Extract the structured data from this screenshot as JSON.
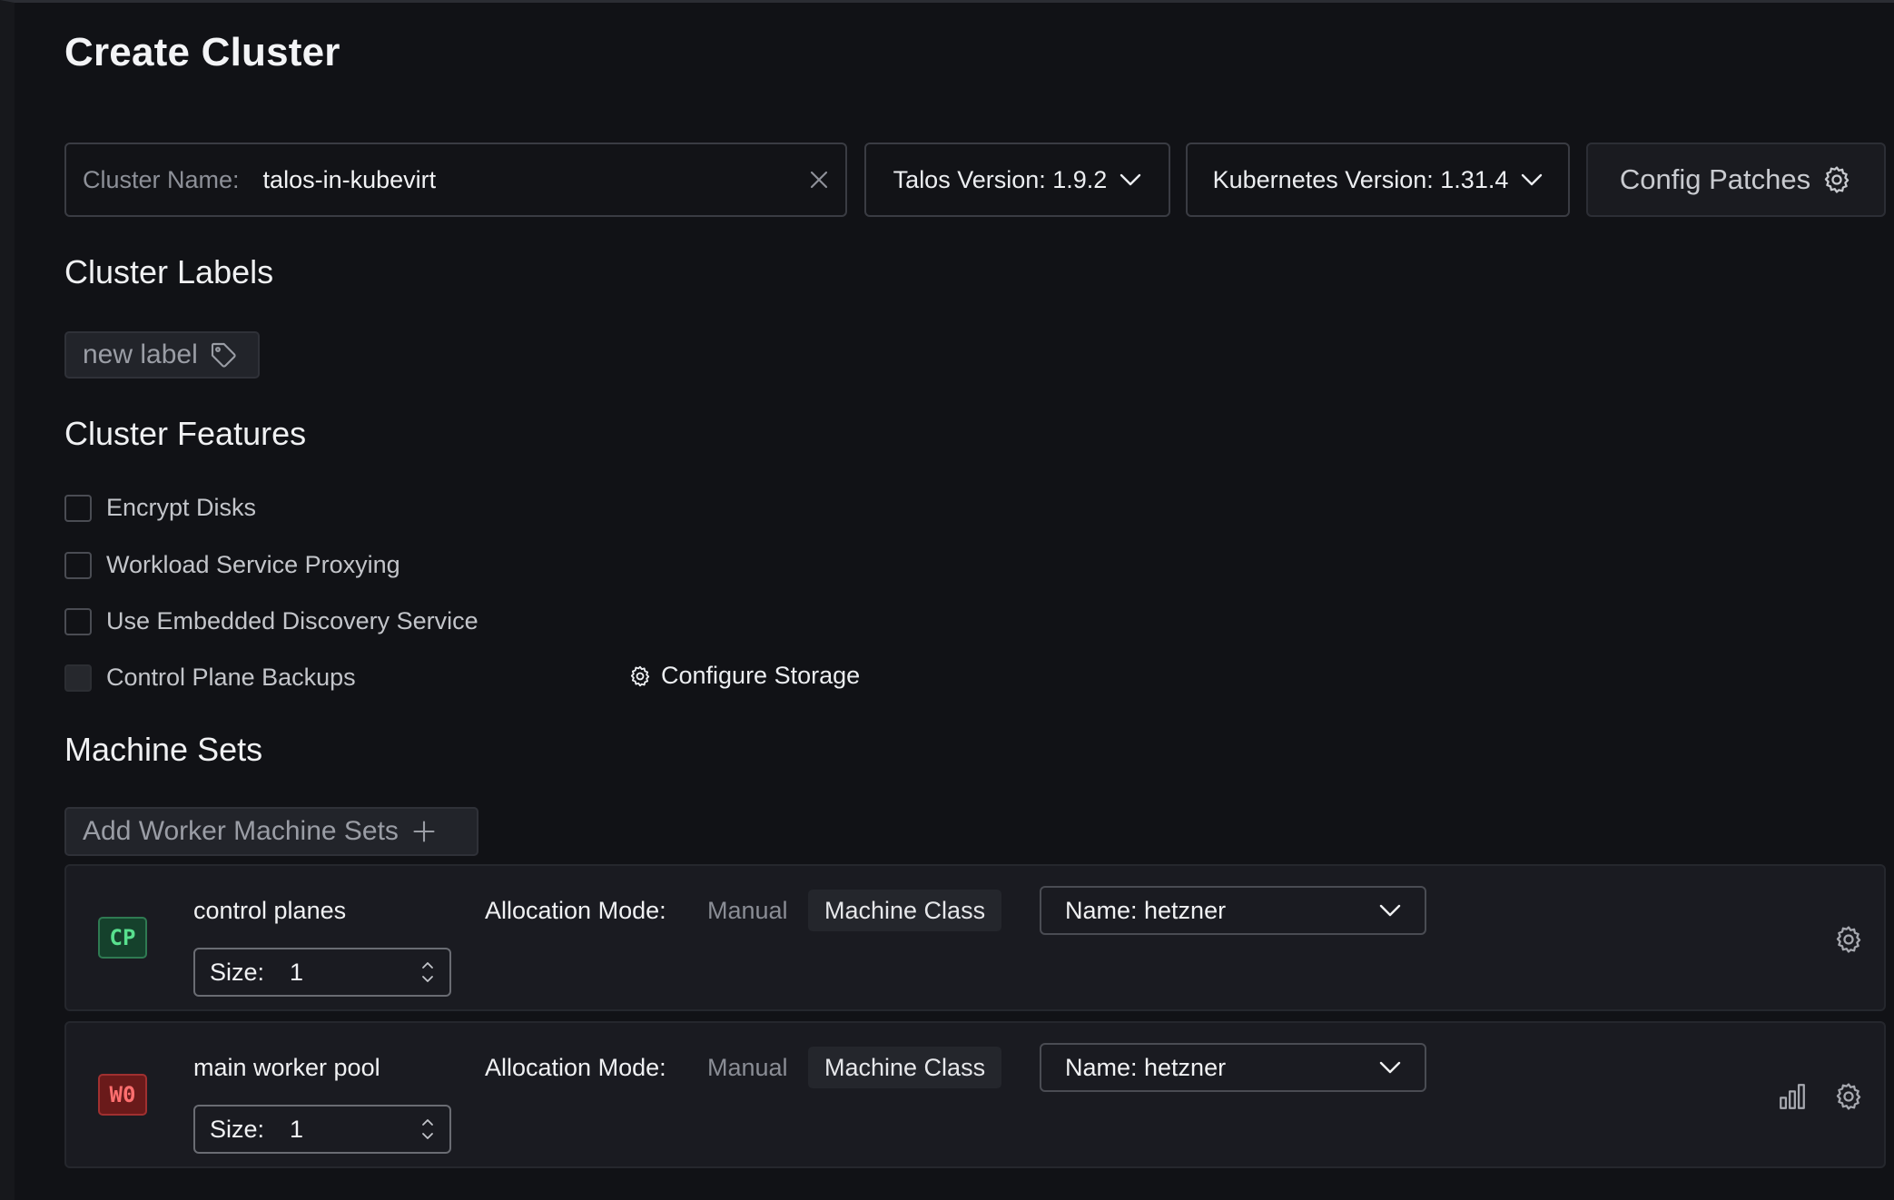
{
  "page": {
    "title": "Create Cluster"
  },
  "cluster_name": {
    "label": "Cluster Name:",
    "value": "talos-in-kubevirt"
  },
  "talos_version": {
    "label": "Talos Version: 1.9.2"
  },
  "kubernetes_version": {
    "label": "Kubernetes Version: 1.31.4"
  },
  "config_patches": {
    "label": "Config Patches",
    "icon": "gear-icon"
  },
  "labels": {
    "title": "Cluster Labels",
    "new_label": "new label",
    "icon": "tag-icon"
  },
  "features": {
    "title": "Cluster Features",
    "items": [
      {
        "label": "Encrypt Disks",
        "checked": false,
        "disabled": false
      },
      {
        "label": "Workload Service Proxying",
        "checked": false,
        "disabled": false
      },
      {
        "label": "Use Embedded Discovery Service",
        "checked": false,
        "disabled": false
      },
      {
        "label": "Control Plane Backups",
        "checked": false,
        "disabled": true
      }
    ],
    "configure_storage": "Configure Storage"
  },
  "machine_sets": {
    "title": "Machine Sets",
    "add_button": "Add Worker Machine Sets",
    "items": [
      {
        "badge": "CP",
        "badge_color": "#58e08e",
        "name": "control planes",
        "size_label": "Size:",
        "size": "1",
        "allocation_label": "Allocation Mode:",
        "mode_manual": "Manual",
        "mode_class": "Machine Class",
        "class_select": "Name: hetzner"
      },
      {
        "badge": "W0",
        "badge_color": "#ff6f6f",
        "name": "main worker pool",
        "size_label": "Size:",
        "size": "1",
        "allocation_label": "Allocation Mode:",
        "mode_manual": "Manual",
        "mode_class": "Machine Class",
        "class_select": "Name: hetzner"
      }
    ]
  },
  "colors": {
    "background": "#111216",
    "panel": "#1a1b21",
    "border": "#3a3c43"
  }
}
